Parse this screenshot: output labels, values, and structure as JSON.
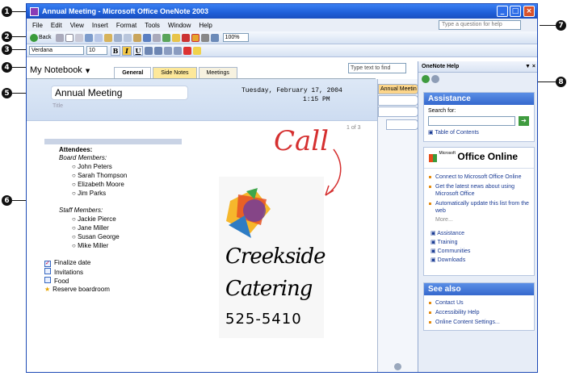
{
  "window": {
    "title": "Annual Meeting - Microsoft Office OneNote 2003",
    "help_placeholder": "Type a question for help"
  },
  "menus": [
    "File",
    "Edit",
    "View",
    "Insert",
    "Format",
    "Tools",
    "Window",
    "Help"
  ],
  "toolbar": {
    "back_label": "Back",
    "zoom": "100%",
    "font": "Verdana",
    "font_size": "10"
  },
  "notebook": {
    "name": "My Notebook",
    "tabs": [
      "General",
      "Side Notes",
      "Meetings"
    ],
    "find_placeholder": "Type text to find"
  },
  "page": {
    "title": "Annual Meeting",
    "title_hint": "Title",
    "date": "Tuesday, February 17, 2004",
    "time": "1:15 PM",
    "page_indicator": "1 of 3",
    "page_tab": "Annual Meetin"
  },
  "notes": {
    "heading": "Attendees:",
    "board_label": "Board Members:",
    "board": [
      "John Peters",
      "Sarah Thompson",
      "Elizabeth Moore",
      "Jim Parks"
    ],
    "staff_label": "Staff Members:",
    "staff": [
      "Jackie Pierce",
      "Jane Miller",
      "Susan George",
      "Mike Miller"
    ],
    "tasks": [
      "Finalize date",
      "Invitations",
      "Food",
      "Reserve boardroom"
    ]
  },
  "ink": {
    "call": "Call",
    "line1": "Creekside",
    "line2": "Catering",
    "phone": "525-5410"
  },
  "taskpane": {
    "title": "OneNote Help",
    "assistance": "Assistance",
    "search_label": "Search for:",
    "toc": "Table of Contents",
    "office_online_small": "Microsoft",
    "office_online": "Office Online",
    "online_links": [
      "Connect to Microsoft Office Online",
      "Get the latest news about using Microsoft Office",
      "Automatically update this list from the web"
    ],
    "more": "More...",
    "resources": [
      "Assistance",
      "Training",
      "Communities",
      "Downloads"
    ],
    "see_also": "See also",
    "see_also_links": [
      "Contact Us",
      "Accessibility Help",
      "Online Content Settings..."
    ]
  },
  "callouts": [
    "1",
    "2",
    "3",
    "4",
    "5",
    "6",
    "7",
    "8"
  ]
}
